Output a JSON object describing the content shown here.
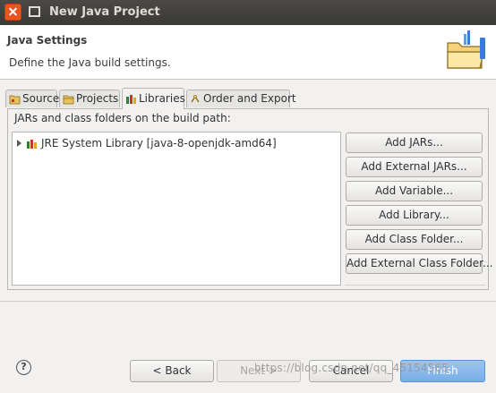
{
  "window": {
    "title": "New Java Project"
  },
  "header": {
    "title": "Java Settings",
    "description": "Define the Java build settings."
  },
  "tabs": [
    {
      "label": "Source",
      "active": false,
      "icon": "source-folder-icon"
    },
    {
      "label": "Projects",
      "active": false,
      "icon": "projects-folder-icon"
    },
    {
      "label": "Libraries",
      "active": true,
      "icon": "libraries-icon"
    },
    {
      "label": "Order and Export",
      "active": false,
      "icon": "order-export-icon"
    }
  ],
  "libraries": {
    "label": "JARs and class folders on the build path:",
    "items": [
      {
        "label": "JRE System Library [java-8-openjdk-amd64]",
        "icon": "jre-library-icon",
        "expanded": false
      }
    ],
    "buttons": {
      "add_jars": "Add JARs...",
      "add_external_jars": "Add External JARs...",
      "add_variable": "Add Variable...",
      "add_library": "Add Library...",
      "add_class_folder": "Add Class Folder...",
      "add_external_class_folder": "Add External Class Folder..."
    }
  },
  "footer": {
    "help": "?",
    "back": "< Back",
    "next": "Next >",
    "cancel": "Cancel",
    "finish": "Finish"
  },
  "watermark": "https://blog.csdn.net/qq_45154565",
  "colors": {
    "titlebar": "#3c3b37",
    "close_button": "#e9541f",
    "default_button": "#78aee8"
  }
}
